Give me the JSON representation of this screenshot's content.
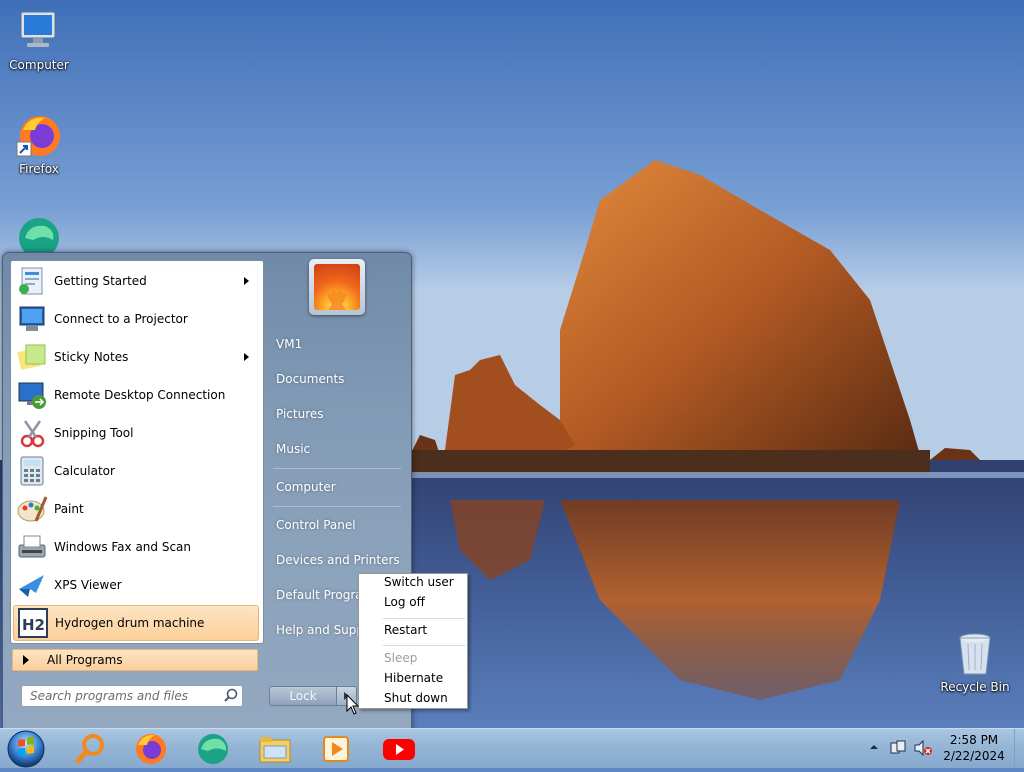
{
  "desktop": {
    "icons": [
      {
        "label": "Computer",
        "icon": "computer-icon"
      },
      {
        "label": "Firefox",
        "icon": "firefox-icon"
      },
      {
        "label": "Recycle Bin",
        "icon": "recycle-bin-icon"
      }
    ]
  },
  "start_menu": {
    "programs": [
      {
        "label": "Getting Started",
        "icon": "getting-started-icon",
        "submenu": true
      },
      {
        "label": "Connect to a Projector",
        "icon": "projector-icon",
        "submenu": false
      },
      {
        "label": "Sticky Notes",
        "icon": "sticky-notes-icon",
        "submenu": true
      },
      {
        "label": "Remote Desktop Connection",
        "icon": "remote-desktop-icon",
        "submenu": false
      },
      {
        "label": "Snipping Tool",
        "icon": "snipping-tool-icon",
        "submenu": false
      },
      {
        "label": "Calculator",
        "icon": "calculator-icon",
        "submenu": false
      },
      {
        "label": "Paint",
        "icon": "paint-icon",
        "submenu": false
      },
      {
        "label": "Windows Fax and Scan",
        "icon": "fax-scan-icon",
        "submenu": false
      },
      {
        "label": "XPS Viewer",
        "icon": "xps-viewer-icon",
        "submenu": false
      },
      {
        "label": "Hydrogen drum machine",
        "icon": "hydrogen-icon",
        "submenu": false,
        "highlighted": true
      }
    ],
    "all_programs": "All Programs",
    "search_placeholder": "Search programs and files",
    "right_links": {
      "user": "VM1",
      "documents": "Documents",
      "pictures": "Pictures",
      "music": "Music",
      "computer": "Computer",
      "control_panel": "Control Panel",
      "devices": "Devices and Printers",
      "default_programs": "Default Programs",
      "help": "Help and Support"
    },
    "lock_label": "Lock"
  },
  "power_menu": {
    "switch_user": "Switch user",
    "log_off": "Log off",
    "restart": "Restart",
    "sleep": "Sleep",
    "hibernate": "Hibernate",
    "shut_down": "Shut down"
  },
  "taskbar": {
    "pinned": [
      "search-app-icon",
      "firefox-icon",
      "edge-icon",
      "file-explorer-icon",
      "media-player-icon",
      "youtube-icon"
    ],
    "clock_time": "2:58 PM",
    "clock_date": "2/22/2024"
  },
  "colors": {
    "highlight": "#fbd09a",
    "menu_frame": "#8099b4",
    "taskbar": "#95b5d5"
  }
}
